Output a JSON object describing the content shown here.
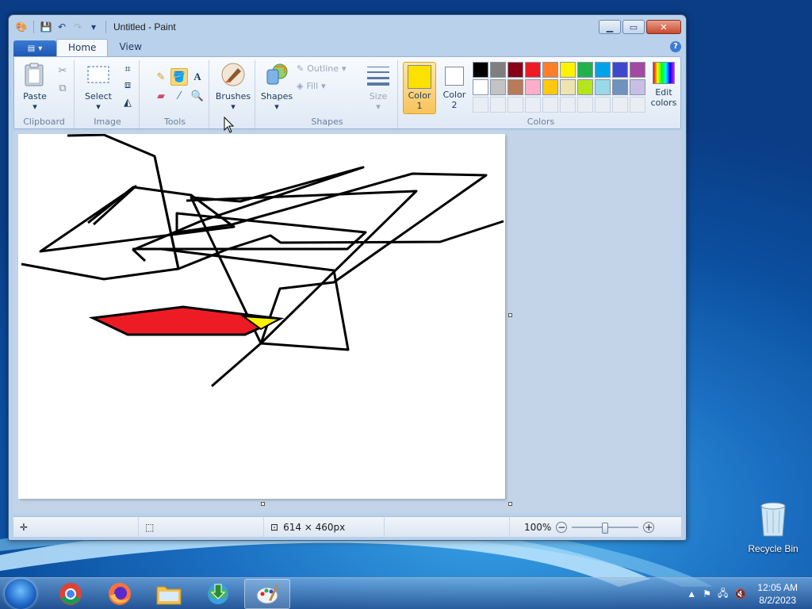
{
  "window": {
    "title": "Untitled - Paint"
  },
  "tabs": [
    {
      "label": "Home"
    },
    {
      "label": "View"
    }
  ],
  "ribbon": {
    "groups": {
      "clipboard": "Clipboard",
      "image": "Image",
      "tools": "Tools",
      "shapes": "Shapes",
      "colors": "Colors"
    },
    "paste": "Paste",
    "select": "Select",
    "brushes": "Brushes",
    "shapes": "Shapes",
    "outline": "Outline",
    "fill": "Fill",
    "size": "Size",
    "color1": "Color\n1",
    "color2": "Color\n2",
    "edit_colors": "Edit\ncolors",
    "color1_value": "#ffe100",
    "color2_value": "#ffffff",
    "palette_row1": [
      "#000000",
      "#7f7f7f",
      "#880015",
      "#ed1c24",
      "#ff7f27",
      "#fff200",
      "#22b14c",
      "#00a2e8",
      "#3f48cc",
      "#a349a4"
    ],
    "palette_row2": [
      "#ffffff",
      "#c3c3c3",
      "#b97a57",
      "#ffaec9",
      "#ffc90e",
      "#efe4b0",
      "#b5e61d",
      "#99d9ea",
      "#7092be",
      "#c8bfe7"
    ]
  },
  "status": {
    "dimensions": "614 × 460px",
    "zoom": "100%"
  },
  "desktop": {
    "recycle_bin": "Recycle Bin"
  },
  "taskbar": {
    "time": "12:05 AM",
    "date": "8/2/2023"
  }
}
